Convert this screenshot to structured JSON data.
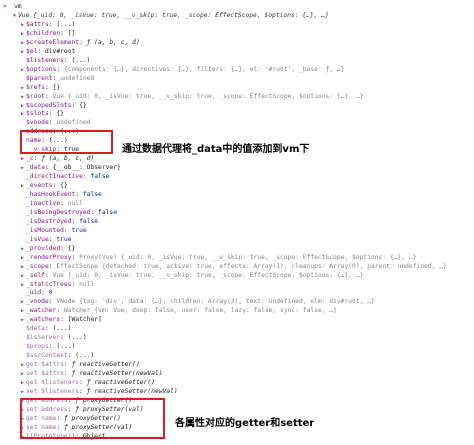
{
  "console": {
    "prompt_symbol": ">",
    "input": "vm",
    "lines": [
      {
        "indent": 0,
        "arrow": "down",
        "key": "",
        "sep": "",
        "value": "Vue {_uid: 0, _isVue: true, __v_skip: true, _scope: EffectScope, $options: {…}, …}",
        "vtype": "obj"
      },
      {
        "indent": 1,
        "arrow": "right",
        "key": "$attrs",
        "sep": ": ",
        "value": "(...)",
        "vtype": "plain"
      },
      {
        "indent": 1,
        "arrow": "right",
        "key": "$children",
        "sep": ": ",
        "value": "[]",
        "vtype": "plain"
      },
      {
        "indent": 1,
        "arrow": "right",
        "key": "$createElement",
        "sep": ": ",
        "value": "ƒ (a, b, c, d)",
        "vtype": "fn"
      },
      {
        "indent": 1,
        "arrow": "right",
        "key": "$el",
        "sep": ": ",
        "value": "div#root",
        "vtype": "plain"
      },
      {
        "indent": 1,
        "arrow": "",
        "key": "$listeners",
        "sep": ": ",
        "value": "(...)",
        "vtype": "plain"
      },
      {
        "indent": 1,
        "arrow": "right",
        "key": "$options",
        "sep": ": ",
        "value": "{components: {…}, directives: {…}, filters: {…}, el: '#root', _base: ƒ, …}",
        "vtype": "gray"
      },
      {
        "indent": 1,
        "arrow": "",
        "key": "$parent",
        "sep": ": ",
        "value": "undefined",
        "vtype": "gray"
      },
      {
        "indent": 1,
        "arrow": "right",
        "key": "$refs",
        "sep": ": ",
        "value": "{}",
        "vtype": "plain"
      },
      {
        "indent": 1,
        "arrow": "right",
        "key": "$root",
        "sep": ": ",
        "value": "Vue {_uid: 0, _isVue: true, __v_skip: true, _scope: EffectScope, $options: {…}, …}",
        "vtype": "gray"
      },
      {
        "indent": 1,
        "arrow": "right",
        "key": "$scopedSlots",
        "sep": ": ",
        "value": "{}",
        "vtype": "plain"
      },
      {
        "indent": 1,
        "arrow": "right",
        "key": "$slots",
        "sep": ": ",
        "value": "{}",
        "vtype": "plain"
      },
      {
        "indent": 1,
        "arrow": "",
        "key": "$vnode",
        "sep": ": ",
        "value": "undefined",
        "vtype": "gray"
      },
      {
        "indent": 1,
        "arrow": "",
        "key": "address",
        "sep": ": ",
        "value": "(...)",
        "vtype": "plain"
      },
      {
        "indent": 1,
        "arrow": "",
        "key": "name",
        "sep": ": ",
        "value": "(...)",
        "vtype": "plain"
      },
      {
        "indent": 1,
        "arrow": "",
        "key": "__v_skip",
        "sep": ": ",
        "value": "true",
        "vtype": "kw"
      },
      {
        "indent": 1,
        "arrow": "right",
        "key": "_c",
        "sep": ": ",
        "value": "ƒ (a, b, c, d)",
        "vtype": "fn"
      },
      {
        "indent": 1,
        "arrow": "right",
        "key": "_data",
        "sep": ": ",
        "value": "{__ob__: Observer}",
        "vtype": "plain"
      },
      {
        "indent": 1,
        "arrow": "",
        "key": "_directInactive",
        "sep": ": ",
        "value": "false",
        "vtype": "kw"
      },
      {
        "indent": 1,
        "arrow": "right",
        "key": "_events",
        "sep": ": ",
        "value": "{}",
        "vtype": "plain"
      },
      {
        "indent": 1,
        "arrow": "",
        "key": "_hasHookEvent",
        "sep": ": ",
        "value": "false",
        "vtype": "kw"
      },
      {
        "indent": 1,
        "arrow": "",
        "key": "_inactive",
        "sep": ": ",
        "value": "null",
        "vtype": "gray"
      },
      {
        "indent": 1,
        "arrow": "",
        "key": "_isBeingDestroyed",
        "sep": ": ",
        "value": "false",
        "vtype": "kw"
      },
      {
        "indent": 1,
        "arrow": "",
        "key": "_isDestroyed",
        "sep": ": ",
        "value": "false",
        "vtype": "kw"
      },
      {
        "indent": 1,
        "arrow": "",
        "key": "_isMounted",
        "sep": ": ",
        "value": "true",
        "vtype": "kw"
      },
      {
        "indent": 1,
        "arrow": "",
        "key": "_isVue",
        "sep": ": ",
        "value": "true",
        "vtype": "kw"
      },
      {
        "indent": 1,
        "arrow": "right",
        "key": "_provided",
        "sep": ": ",
        "value": "{}",
        "vtype": "plain"
      },
      {
        "indent": 1,
        "arrow": "right",
        "key": "_renderProxy",
        "sep": ": ",
        "value": "Proxy(Vue) {_uid: 0, _isVue: true, __v_skip: true, _scope: EffectScope, $options: {…}, …}",
        "vtype": "gray"
      },
      {
        "indent": 1,
        "arrow": "right",
        "key": "_scope",
        "sep": ": ",
        "value": "EffectScope {detached: true, active: true, effects: Array(1), cleanups: Array(0), parent: undefined, …}",
        "vtype": "gray"
      },
      {
        "indent": 1,
        "arrow": "right",
        "key": "_self",
        "sep": ": ",
        "value": "Vue {_uid: 0, _isVue: true, __v_skip: true, _scope: EffectScope, $options: {…}, …}",
        "vtype": "gray"
      },
      {
        "indent": 1,
        "arrow": "right",
        "key": "_staticTrees",
        "sep": ": ",
        "value": "null",
        "vtype": "gray"
      },
      {
        "indent": 1,
        "arrow": "",
        "key": "_uid",
        "sep": ": ",
        "value": "0",
        "vtype": "num"
      },
      {
        "indent": 1,
        "arrow": "right",
        "key": "_vnode",
        "sep": ": ",
        "value": "VNode {tag: 'div', data: {…}, children: Array(3), text: undefined, elm: div#root, …}",
        "vtype": "gray"
      },
      {
        "indent": 1,
        "arrow": "right",
        "key": "_watcher",
        "sep": ": ",
        "value": "Watcher {vm: Vue, deep: false, user: false, lazy: false, sync: false, …}",
        "vtype": "gray"
      },
      {
        "indent": 1,
        "arrow": "right",
        "key": "_watchers",
        "sep": ": ",
        "value": "[Watcher]",
        "vtype": "plain"
      },
      {
        "indent": 1,
        "arrow": "",
        "key": "$data",
        "sep": ": ",
        "value": "(...)",
        "vtype": "plain",
        "dim": true
      },
      {
        "indent": 1,
        "arrow": "",
        "key": "$isServer",
        "sep": ": ",
        "value": "(...)",
        "vtype": "plain",
        "dim": true
      },
      {
        "indent": 1,
        "arrow": "",
        "key": "$props",
        "sep": ": ",
        "value": "(...)",
        "vtype": "plain",
        "dim": true
      },
      {
        "indent": 1,
        "arrow": "",
        "key": "$ssrContext",
        "sep": ": ",
        "value": "(...)",
        "vtype": "plain",
        "dim": true
      },
      {
        "indent": 1,
        "arrow": "right",
        "key": "get $attrs",
        "sep": ": ",
        "value": "ƒ reactiveGetter()",
        "vtype": "fn",
        "dim": true
      },
      {
        "indent": 1,
        "arrow": "right",
        "key": "set $attrs",
        "sep": ": ",
        "value": "ƒ reactiveSetter(newVal)",
        "vtype": "fn",
        "dim": true
      },
      {
        "indent": 1,
        "arrow": "right",
        "key": "get $listeners",
        "sep": ": ",
        "value": "ƒ reactiveGetter()",
        "vtype": "fn",
        "dim": true
      },
      {
        "indent": 1,
        "arrow": "right",
        "key": "set $listeners",
        "sep": ": ",
        "value": "ƒ reactiveSetter(newVal)",
        "vtype": "fn",
        "dim": true
      },
      {
        "indent": 1,
        "arrow": "right",
        "key": "get address",
        "sep": ": ",
        "value": "ƒ proxyGetter()",
        "vtype": "fn",
        "dim": true
      },
      {
        "indent": 1,
        "arrow": "right",
        "key": "set address",
        "sep": ": ",
        "value": "ƒ proxySetter(val)",
        "vtype": "fn",
        "dim": true
      },
      {
        "indent": 1,
        "arrow": "right",
        "key": "get name",
        "sep": ": ",
        "value": "ƒ proxyGetter()",
        "vtype": "fn",
        "dim": true
      },
      {
        "indent": 1,
        "arrow": "right",
        "key": "set name",
        "sep": ": ",
        "value": "ƒ proxySetter(val)",
        "vtype": "fn",
        "dim": true
      },
      {
        "indent": 1,
        "arrow": "right",
        "key": "[[Prototype]]",
        "sep": ": ",
        "value": "Object",
        "vtype": "plain",
        "dim": true
      }
    ]
  },
  "annotations": {
    "top": "通过数据代理将_data中的值添加到vm下",
    "bottom": "各属性对应的getter和setter"
  },
  "colors": {
    "highlight_border": "#d81e1e",
    "key": "#881391",
    "string": "#c41a16",
    "number": "#1c00cf"
  }
}
